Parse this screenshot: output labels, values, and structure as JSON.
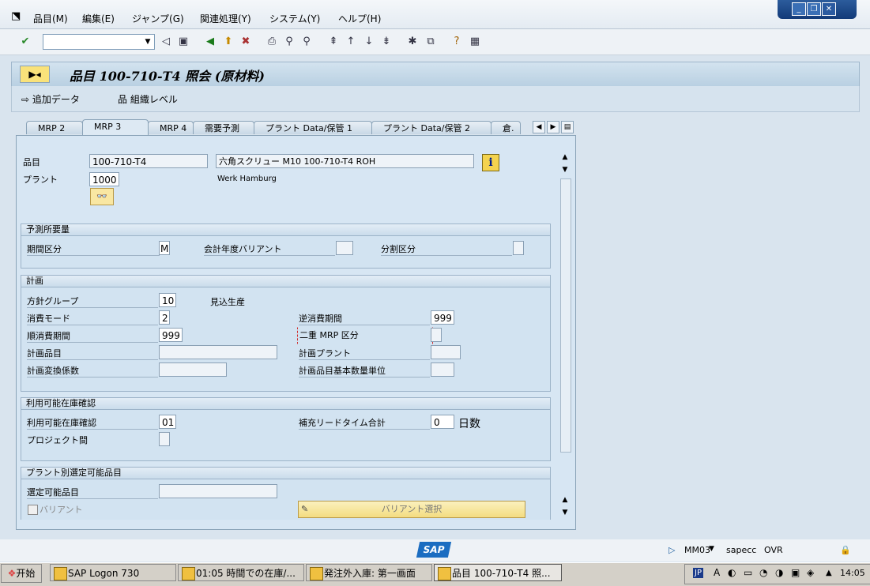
{
  "menu": [
    "品目(M)",
    "編集(E)",
    "ジャンプ(G)",
    "関連処理(Y)",
    "システム(Y)",
    "ヘルプ(H)"
  ],
  "window_controls": {
    "minimize": "_",
    "restore": "❐",
    "close": "✕"
  },
  "toolbar": {
    "command_field": "",
    "icons": [
      "enter-icon",
      "back-icon",
      "save-icon",
      "back-nav-icon",
      "exit-icon",
      "cancel-icon",
      "print-icon",
      "find-icon",
      "find-next-icon",
      "first-page-icon",
      "prev-page-icon",
      "next-page-icon",
      "last-page-icon",
      "create-session-icon",
      "shortcut-icon",
      "help-icon",
      "layout-icon"
    ]
  },
  "title": "品目 100-710-T4 照会 (原材料)",
  "app_toolbar": {
    "additional_data": "追加データ",
    "org_levels": "組織レベル"
  },
  "tabs": [
    "MRP 2",
    "MRP 3",
    "MRP 4",
    "需要予測",
    "プラント Data/保管 1",
    "プラント Data/保管 2",
    "倉."
  ],
  "active_tab": "MRP 3",
  "header": {
    "material_label": "品目",
    "material_value": "100-710-T4",
    "material_desc": "六角スクリュー M10 100-710-T4 ROH",
    "plant_label": "プラント",
    "plant_value": "1000",
    "plant_name": "Werk Hamburg"
  },
  "forecast": {
    "title": "予測所要量",
    "period_label": "期間区分",
    "period_value": "M",
    "fiscal_label": "会計年度バリアント",
    "fiscal_value": "",
    "split_label": "分割区分",
    "split_value": ""
  },
  "planning": {
    "title": "計画",
    "strategy_label": "方針グループ",
    "strategy_value": "10",
    "strategy_text": "見込生産",
    "consumption_mode_label": "消費モード",
    "consumption_mode_value": "2",
    "backward_label": "逆消費期間",
    "backward_value": "999",
    "forward_label": "順消費期間",
    "forward_value": "999",
    "mixed_mrp_label": "二重 MRP 区分",
    "mixed_mrp_value": "",
    "planning_material_label": "計画品目",
    "planning_material_value": "",
    "planning_plant_label": "計画プラント",
    "planning_plant_value": "",
    "conversion_label": "計画変換係数",
    "conversion_value": "",
    "base_uom_label": "計画品目基本数量単位",
    "base_uom_value": ""
  },
  "availability": {
    "title": "利用可能在庫確認",
    "check_label": "利用可能在庫確認",
    "check_value": "01",
    "replenish_label": "補充リードタイム合計",
    "replenish_value": "0",
    "replenish_unit": "日数",
    "cross_project_label": "プロジェクト間",
    "cross_project_value": ""
  },
  "plant_specific": {
    "title": "プラント別選定可能品目",
    "selectable_label": "選定可能品目",
    "selectable_value": "",
    "variant_checkbox": "バリアント",
    "variant_button": "バリアント選択"
  },
  "status": {
    "logo": "SAP",
    "transaction": "MM03",
    "server": "sapecc",
    "mode": "OVR"
  },
  "taskbar": {
    "start": "开始",
    "tasks": [
      "SAP Logon 730",
      "01:05 時間での在庫/...",
      "発注外入庫: 第一画面",
      "品目 100-710-T4 照..."
    ],
    "lang": "JP",
    "time": "14:05"
  }
}
